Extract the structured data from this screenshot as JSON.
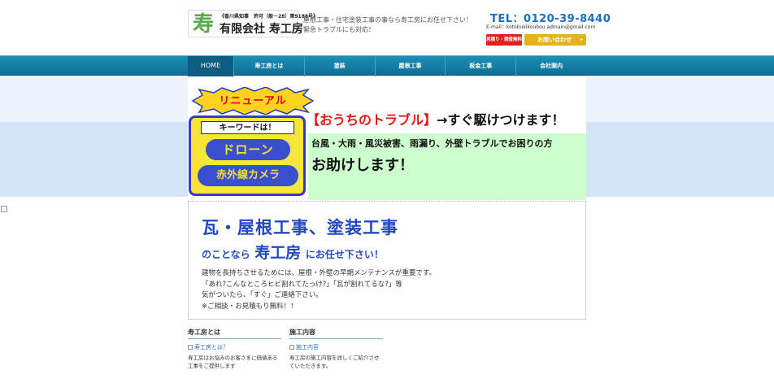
{
  "header": {
    "logo_mark": "寿",
    "license": "《香川県知事　許可（般－28）第9188号》",
    "company": "有限会社 寿工房",
    "tagline_line1": "屋根工事・住宅塗装工事の事なら寿工房にお任せ下さい！",
    "tagline_line2": "緊急トラブルにも対応！",
    "tel": "TEL：0120-39-8440",
    "email": "E-mail：kotobukikoubou.admain@gmail.com",
    "estimate_button": "見積り・調査無料",
    "contact_button": "お問い合わせ",
    "contact_arrow": "▸"
  },
  "nav": {
    "items": [
      {
        "label": "HOME"
      },
      {
        "label": "寿工房とは"
      },
      {
        "label": "塗装"
      },
      {
        "label": "屋根工事"
      },
      {
        "label": "板金工事"
      },
      {
        "label": "会社案内"
      }
    ]
  },
  "hero": {
    "renewal": "リニューアル",
    "keyword_label": "キーワードは！",
    "keyword_drone": "ドローン",
    "keyword_ir": "赤外線カメラ",
    "trouble_open": "【",
    "trouble_text": "おうちのトラブル",
    "trouble_close": "】",
    "trouble_rest": "→すぐ駆けつけます！",
    "desc": "台風・大雨・風災被害、雨漏り、外壁トラブルでお困りの方",
    "help": "お助けします！"
  },
  "intro": {
    "title_line1": "瓦・屋根工事、塗装工事",
    "title_prefix": "のことなら",
    "title_brand": "寿工房",
    "title_suffix": "にお任せ下さい！",
    "body_line1": "建物を長持ちさせるためには、屋根・外壁の早期メンテナンスが重要です。",
    "body_line2": "「あれ?こんなところヒビ割れてたっけ?」「瓦が割れてるな?」等",
    "body_line3": "気がついたら、「すぐ」ご連絡下さい。",
    "body_line4": "※ご相談・お見積もり無料！！"
  },
  "bottom": {
    "col1_title": "寿工房とは",
    "col1_img_alt": "寿工房とは？",
    "col1_text": "寿工房はお悩みのお客さまに価値ある工事をご提供します",
    "col2_title": "施工内容",
    "col2_img_alt": "施工内容",
    "col2_text": "寿工房の施工内容を詳しくご紹介させていただきます。"
  },
  "colors": {
    "nav_bg": "#1c8fb5",
    "accent_blue": "#2247c4",
    "tel_blue": "#1a6fc2",
    "estimate_red": "#e0201c",
    "contact_gold": "#e5b21b",
    "hero_green": "#ccffcc"
  },
  "icons": [
    "broken-image-icon",
    "starburst-icon",
    "arrow-icon"
  ]
}
